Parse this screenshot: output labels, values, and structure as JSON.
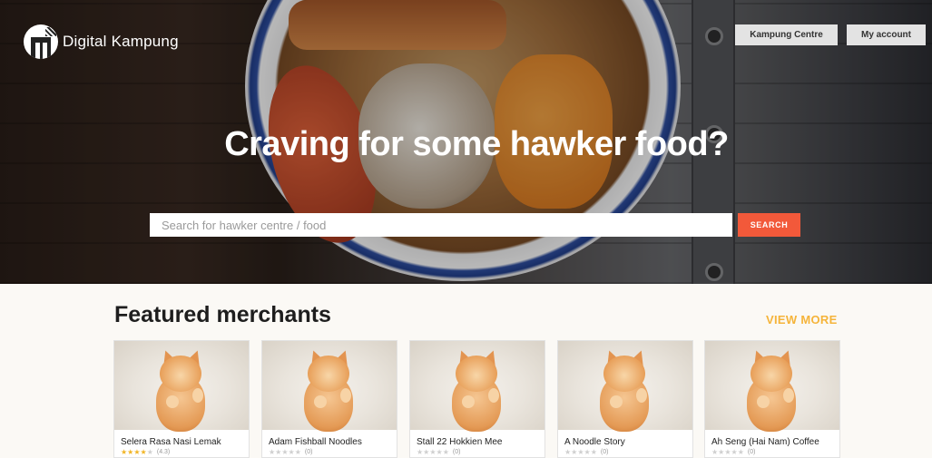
{
  "brand": {
    "name": "Digital Kampung"
  },
  "nav": {
    "centre_label": "Kampung Centre",
    "account_label": "My account"
  },
  "hero": {
    "headline": "Craving for some hawker food?",
    "search_placeholder": "Search for hawker centre / food",
    "search_label": "SEARCH"
  },
  "featured": {
    "title": "Featured merchants",
    "view_more": "VIEW MORE",
    "merchants": [
      {
        "name": "Selera Rasa Nasi Lemak",
        "stars": "★★★★★",
        "rating_value": 4,
        "count": "(4.3)"
      },
      {
        "name": "Adam Fishball Noodles",
        "stars": "★★★★★",
        "rating_value": 0,
        "count": "(0)"
      },
      {
        "name": "Stall 22 Hokkien Mee",
        "stars": "★★★★★",
        "rating_value": 0,
        "count": "(0)"
      },
      {
        "name": "A Noodle Story",
        "stars": "★★★★★",
        "rating_value": 0,
        "count": "(0)"
      },
      {
        "name": "Ah Seng (Hai Nam) Coffee",
        "stars": "★★★★★",
        "rating_value": 0,
        "count": "(0)"
      }
    ]
  },
  "colors": {
    "accent": "#f2593a",
    "link": "#f5b43a",
    "star": "#f1b526"
  }
}
